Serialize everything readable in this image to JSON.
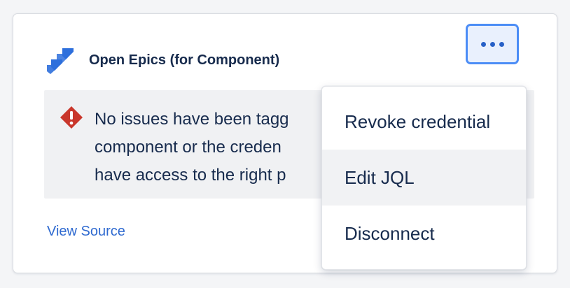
{
  "card": {
    "title": "Open Epics (for Component)",
    "logo_icon": "jira-logo-icon",
    "more_button_icon": "more-horizontal-icon",
    "message_icon": "error-diamond-icon",
    "message_lines": [
      "No issues have been tagg",
      "component or the creden",
      "have access to the right p"
    ],
    "view_source": "View Source"
  },
  "menu": {
    "items": [
      {
        "label": "Revoke credential",
        "hovered": false
      },
      {
        "label": "Edit JQL",
        "hovered": true
      },
      {
        "label": "Disconnect",
        "hovered": false
      }
    ]
  },
  "colors": {
    "accent": "#4c8df6",
    "link": "#2f6ad0",
    "logo": "#2d6fdc",
    "warning": "#c9372c",
    "text": "#172b4d"
  }
}
